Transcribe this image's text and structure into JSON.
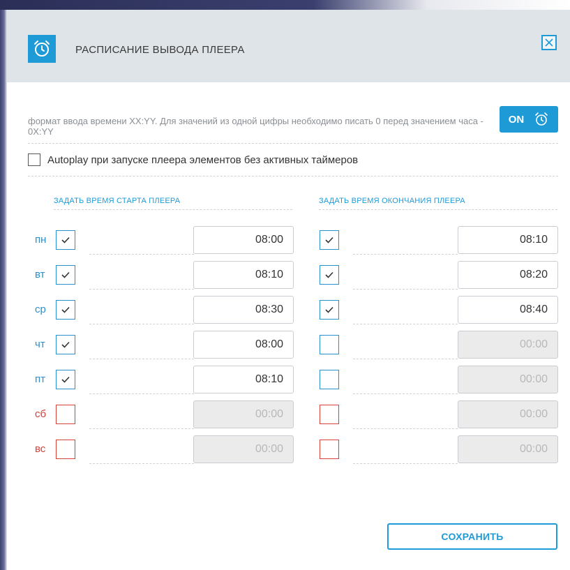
{
  "header": {
    "title": "РАСПИСАНИЕ ВЫВОДА ПЛЕЕРА"
  },
  "hint": "формат ввода времени XX:YY. Для значений из одной цифры необходимо писать 0 перед значением часа - 0X:YY",
  "toggle": {
    "label": "ON"
  },
  "autoplay": {
    "label": "Autoplay при запуске плеера элементов без активных таймеров",
    "checked": false
  },
  "columns": {
    "start": "ЗАДАТЬ ВРЕМЯ СТАРТА ПЛЕЕРА",
    "end": "ЗАДАТЬ ВРЕМЯ ОКОНЧАНИЯ ПЛЕЕРА"
  },
  "days": [
    {
      "label": "пн",
      "start_checked": true,
      "start_time": "08:00",
      "end_checked": true,
      "end_time": "08:10"
    },
    {
      "label": "вт",
      "start_checked": true,
      "start_time": "08:10",
      "end_checked": true,
      "end_time": "08:20"
    },
    {
      "label": "ср",
      "start_checked": true,
      "start_time": "08:30",
      "end_checked": true,
      "end_time": "08:40"
    },
    {
      "label": "чт",
      "start_checked": true,
      "start_time": "08:00",
      "end_checked": false,
      "end_time": "00:00"
    },
    {
      "label": "пт",
      "start_checked": true,
      "start_time": "08:10",
      "end_checked": false,
      "end_time": "00:00"
    },
    {
      "label": "сб",
      "start_checked": false,
      "start_time": "00:00",
      "end_checked": false,
      "end_time": "00:00"
    },
    {
      "label": "вс",
      "start_checked": false,
      "start_time": "00:00",
      "end_checked": false,
      "end_time": "00:00"
    }
  ],
  "save_label": "СОХРАНИТЬ",
  "colors": {
    "accent": "#1e9bd6",
    "weekday": "#2a8fcf",
    "weekend": "#d2423b",
    "header_bg": "#dfe4e8"
  }
}
